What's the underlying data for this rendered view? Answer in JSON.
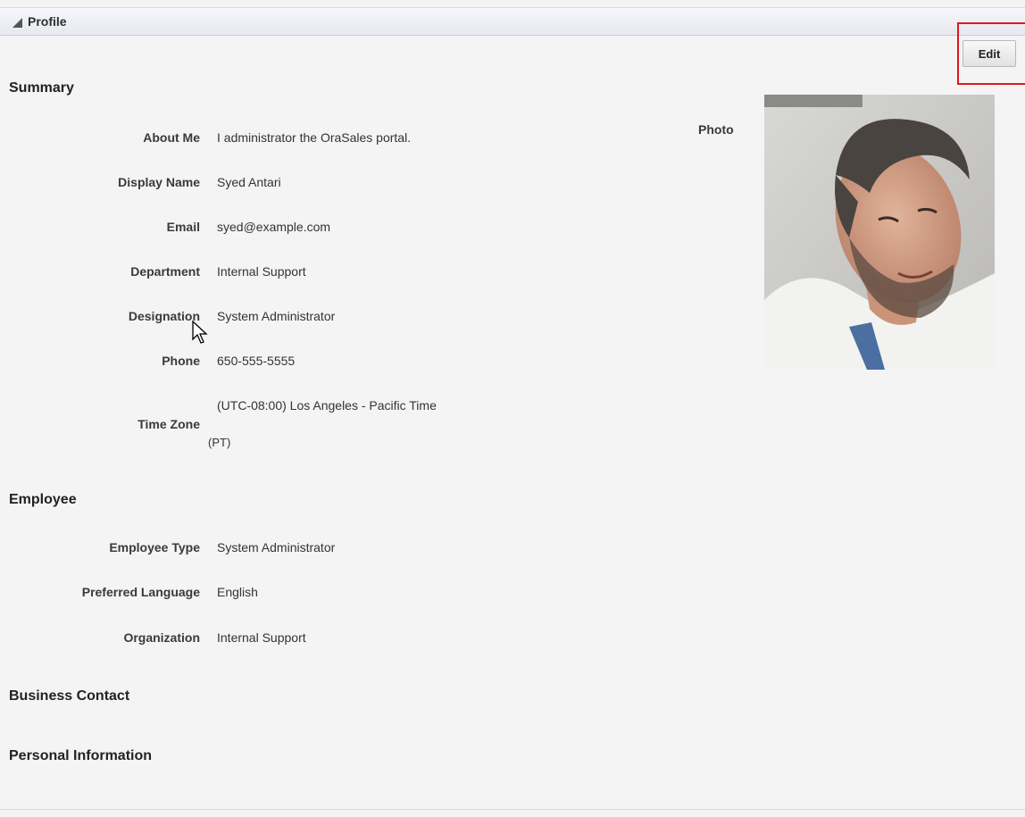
{
  "header": {
    "title": "Profile"
  },
  "toolbar": {
    "edit_label": "Edit"
  },
  "sections": {
    "summary": "Summary",
    "employee": "Employee",
    "business_contact": "Business Contact",
    "personal_information": "Personal Information"
  },
  "summary": {
    "about_me": {
      "label": "About Me",
      "value": "I administrator the OraSales portal."
    },
    "display_name": {
      "label": "Display Name",
      "value": "Syed Antari"
    },
    "email": {
      "label": "Email",
      "value": "syed@example.com"
    },
    "department": {
      "label": "Department",
      "value": "Internal Support"
    },
    "designation": {
      "label": "Designation",
      "value": "System Administrator"
    },
    "phone": {
      "label": "Phone",
      "value": "650-555-5555"
    },
    "time_zone": {
      "label": "Time Zone",
      "value_line1": "(UTC-08:00) Los Angeles - Pacific Time",
      "value_line2": "(PT)"
    },
    "photo_label": "Photo"
  },
  "employee": {
    "employee_type": {
      "label": "Employee Type",
      "value": "System Administrator"
    },
    "preferred_language": {
      "label": "Preferred Language",
      "value": "English"
    },
    "organization": {
      "label": "Organization",
      "value": "Internal Support"
    }
  }
}
